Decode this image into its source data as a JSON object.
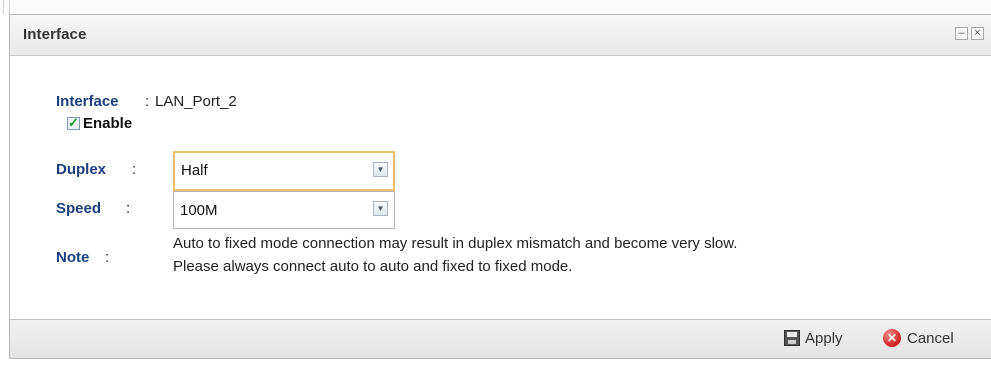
{
  "dialog": {
    "title": "Interface",
    "minimize_glyph": "–",
    "close_glyph": "×"
  },
  "form": {
    "interface_label": "Interface",
    "interface_value": "LAN_Port_2",
    "enable_label": "Enable",
    "enable_checked": true,
    "duplex_label": "Duplex",
    "duplex_value": "Half",
    "speed_label": "Speed",
    "speed_value": "100M",
    "note_label": "Note",
    "note_line1": "Auto to fixed mode connection may result in duplex mismatch and become very slow.",
    "note_line2": "Please always connect auto to auto and fixed to fixed mode.",
    "colon": ":"
  },
  "footer": {
    "apply_label": "Apply",
    "cancel_label": "Cancel"
  },
  "icons": {
    "minimize": "minimize-icon",
    "close": "close-icon",
    "checkbox": "checkbox-checked-icon",
    "dropdown": "chevron-down-icon",
    "apply": "save-icon",
    "cancel": "cancel-icon"
  },
  "colors": {
    "label_blue": "#1c3f7e",
    "focus_orange": "#f0bf6c",
    "cancel_red": "#d42a2a"
  }
}
